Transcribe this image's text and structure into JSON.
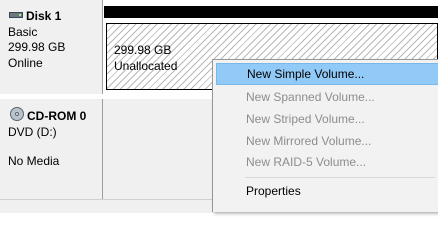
{
  "disk1": {
    "name": "Disk 1",
    "type": "Basic",
    "size": "299.98 GB",
    "status": "Online",
    "partition": {
      "size": "299.98 GB",
      "label": "Unallocated"
    }
  },
  "cdrom": {
    "name": "CD-ROM 0",
    "drive": "DVD (D:)",
    "media": "No Media"
  },
  "context_menu": {
    "items": [
      {
        "label": "New Simple Volume...",
        "enabled": true,
        "highlighted": true
      },
      {
        "label": "New Spanned Volume...",
        "enabled": false
      },
      {
        "label": "New Striped Volume...",
        "enabled": false
      },
      {
        "label": "New Mirrored Volume...",
        "enabled": false
      },
      {
        "label": "New RAID-5 Volume...",
        "enabled": false
      },
      {
        "label": "Properties",
        "enabled": true
      }
    ]
  },
  "icons": {
    "disk": "hard-disk-icon",
    "cdrom": "cdrom-icon"
  }
}
